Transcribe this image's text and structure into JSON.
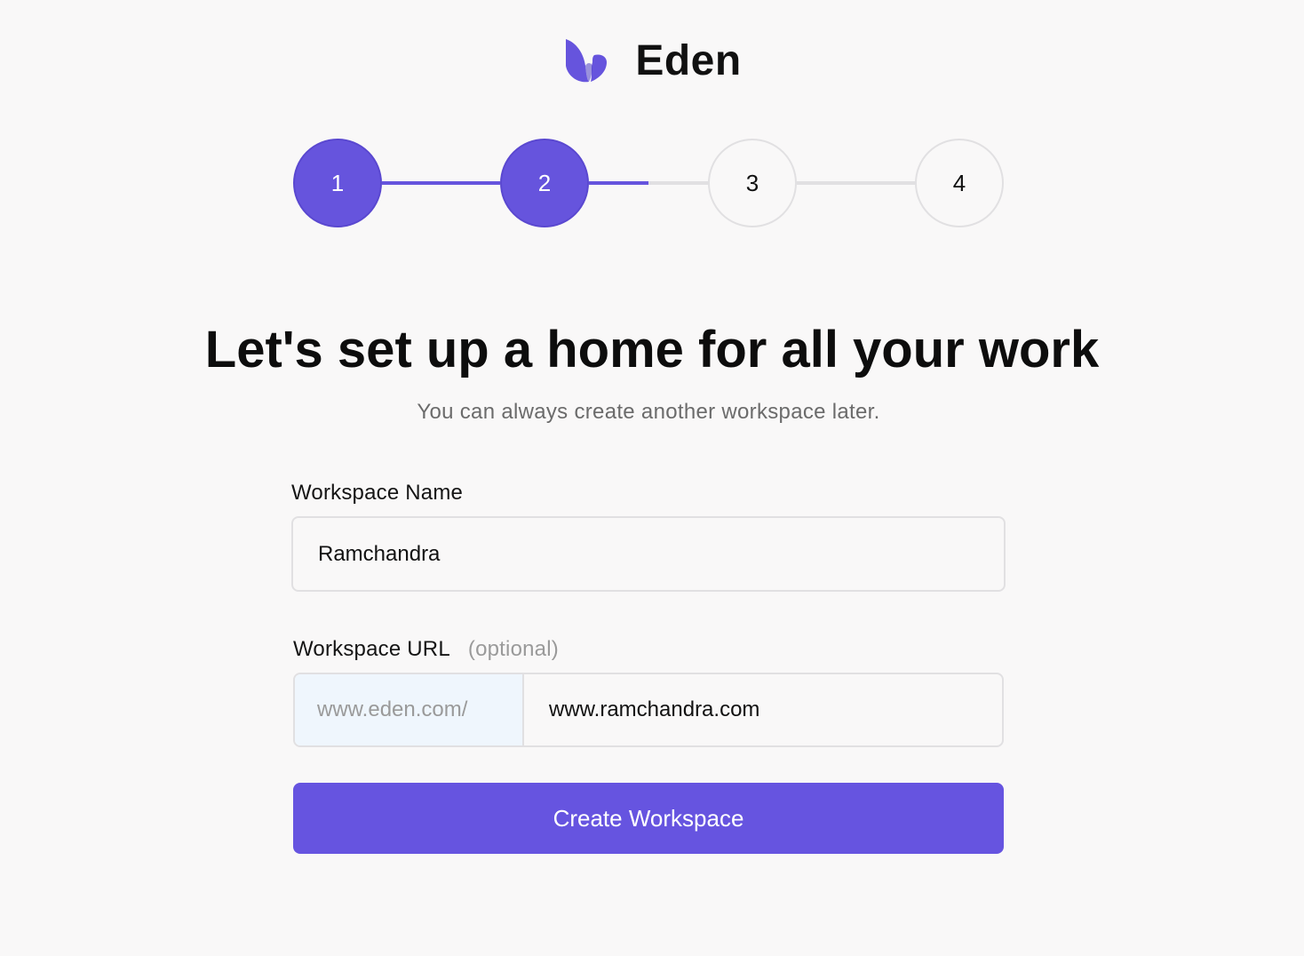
{
  "brand": {
    "name": "Eden",
    "accent_color": "#6654dd",
    "logo_icon": "leaf-icon"
  },
  "stepper": {
    "steps": [
      {
        "label": "1",
        "state": "completed"
      },
      {
        "label": "2",
        "state": "current"
      },
      {
        "label": "3",
        "state": "upcoming"
      },
      {
        "label": "4",
        "state": "upcoming"
      }
    ],
    "progress_fraction": 0.5
  },
  "header": {
    "title": "Let's set up a home for all your work",
    "subtitle": "You can always create another workspace later."
  },
  "form": {
    "workspace_name": {
      "label": "Workspace Name",
      "value": "Ramchandra"
    },
    "workspace_url": {
      "label": "Workspace URL",
      "optional_hint": "(optional)",
      "prefix": "www.eden.com/",
      "value": "www.ramchandra.com"
    },
    "submit_label": "Create Workspace"
  }
}
